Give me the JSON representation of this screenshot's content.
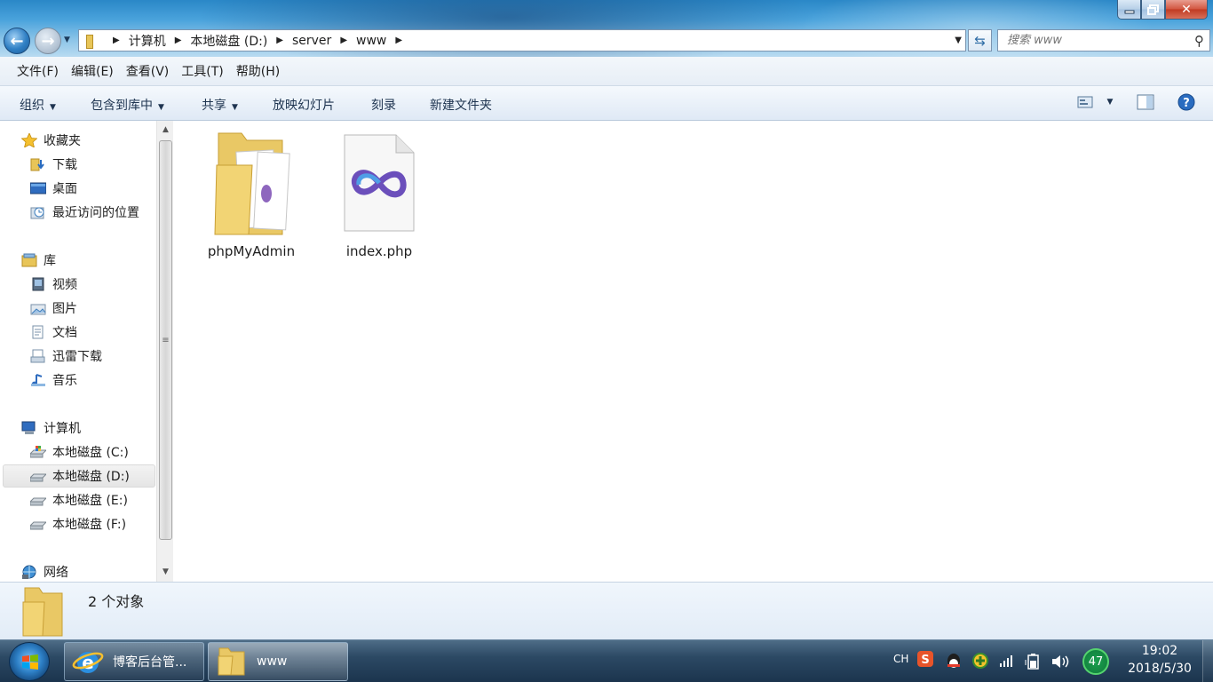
{
  "window": {
    "min_icon": "minimize-icon",
    "max_icon": "maximize-icon",
    "close_icon": "close-icon"
  },
  "address_bar": {
    "crumbs": [
      "计算机",
      "本地磁盘 (D:)",
      "server",
      "www"
    ]
  },
  "search": {
    "placeholder": "搜索 www"
  },
  "menu": [
    "文件(F)",
    "编辑(E)",
    "查看(V)",
    "工具(T)",
    "帮助(H)"
  ],
  "toolbar": {
    "organize": "组织",
    "include_in_library": "包含到库中",
    "share": "共享",
    "slideshow": "放映幻灯片",
    "burn": "刻录",
    "new_folder": "新建文件夹"
  },
  "nav_pane": {
    "favorites": {
      "title": "收藏夹",
      "items": [
        "下载",
        "桌面",
        "最近访问的位置"
      ]
    },
    "libraries": {
      "title": "库",
      "items": [
        "视频",
        "图片",
        "文档",
        "迅雷下载",
        "音乐"
      ]
    },
    "computer": {
      "title": "计算机",
      "items": [
        "本地磁盘 (C:)",
        "本地磁盘 (D:)",
        "本地磁盘 (E:)",
        "本地磁盘 (F:)"
      ],
      "selected": "本地磁盘 (D:)"
    },
    "network": {
      "title": "网络"
    }
  },
  "files": [
    {
      "name": "phpMyAdmin",
      "type": "folder"
    },
    {
      "name": "index.php",
      "type": "file"
    }
  ],
  "details": {
    "count": "2 个对象"
  },
  "taskbar": {
    "buttons": [
      {
        "label": "博客后台管...",
        "icon": "ie-icon"
      },
      {
        "label": "www",
        "icon": "folder-icon"
      }
    ],
    "tray": {
      "lang": "CH",
      "badge": "47",
      "time": "19:02",
      "date": "2018/5/30"
    }
  },
  "colors": {
    "accent": "#2f7fc4",
    "selection_bg": "#e5e5e5",
    "folder_yellow": "#e8c558",
    "taskbar": "#1b344d"
  }
}
